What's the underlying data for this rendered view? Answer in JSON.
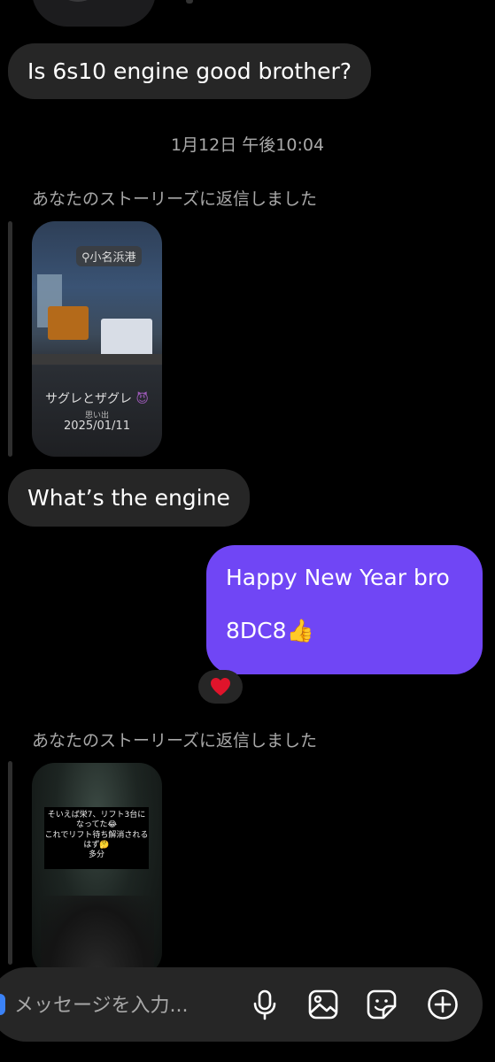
{
  "messages": {
    "first_incoming": "Is 6s10 engine good brother?",
    "timestamp": "1月12日 午後10:04",
    "story_reply_label_1": "あなたのストーリーズに返信しました",
    "story1": {
      "location": "小名浜港",
      "caption": "サグレとザグレ",
      "sub": "思い出",
      "date": "2025/01/11"
    },
    "second_incoming": "What’s the engine",
    "outgoing": {
      "line1": "Happy New Year bro",
      "line2": "8DC8👍"
    },
    "reaction": "heart",
    "story_reply_label_2": "あなたのストーリーズに返信しました",
    "story2": {
      "text": "そいえば栄7、リフト3台になってた😂\nこれでリフト待ち解消される\nはず🤔\n多分"
    }
  },
  "composer": {
    "placeholder": "メッセージを入力..."
  },
  "colors": {
    "background": "#000000",
    "incoming_bubble": "#262626",
    "outgoing_bubble": "#7046f5",
    "heart": "#e0142b"
  },
  "icons": [
    "microphone-icon",
    "image-icon",
    "sticker-icon",
    "plus-circle-icon",
    "heart-icon"
  ]
}
